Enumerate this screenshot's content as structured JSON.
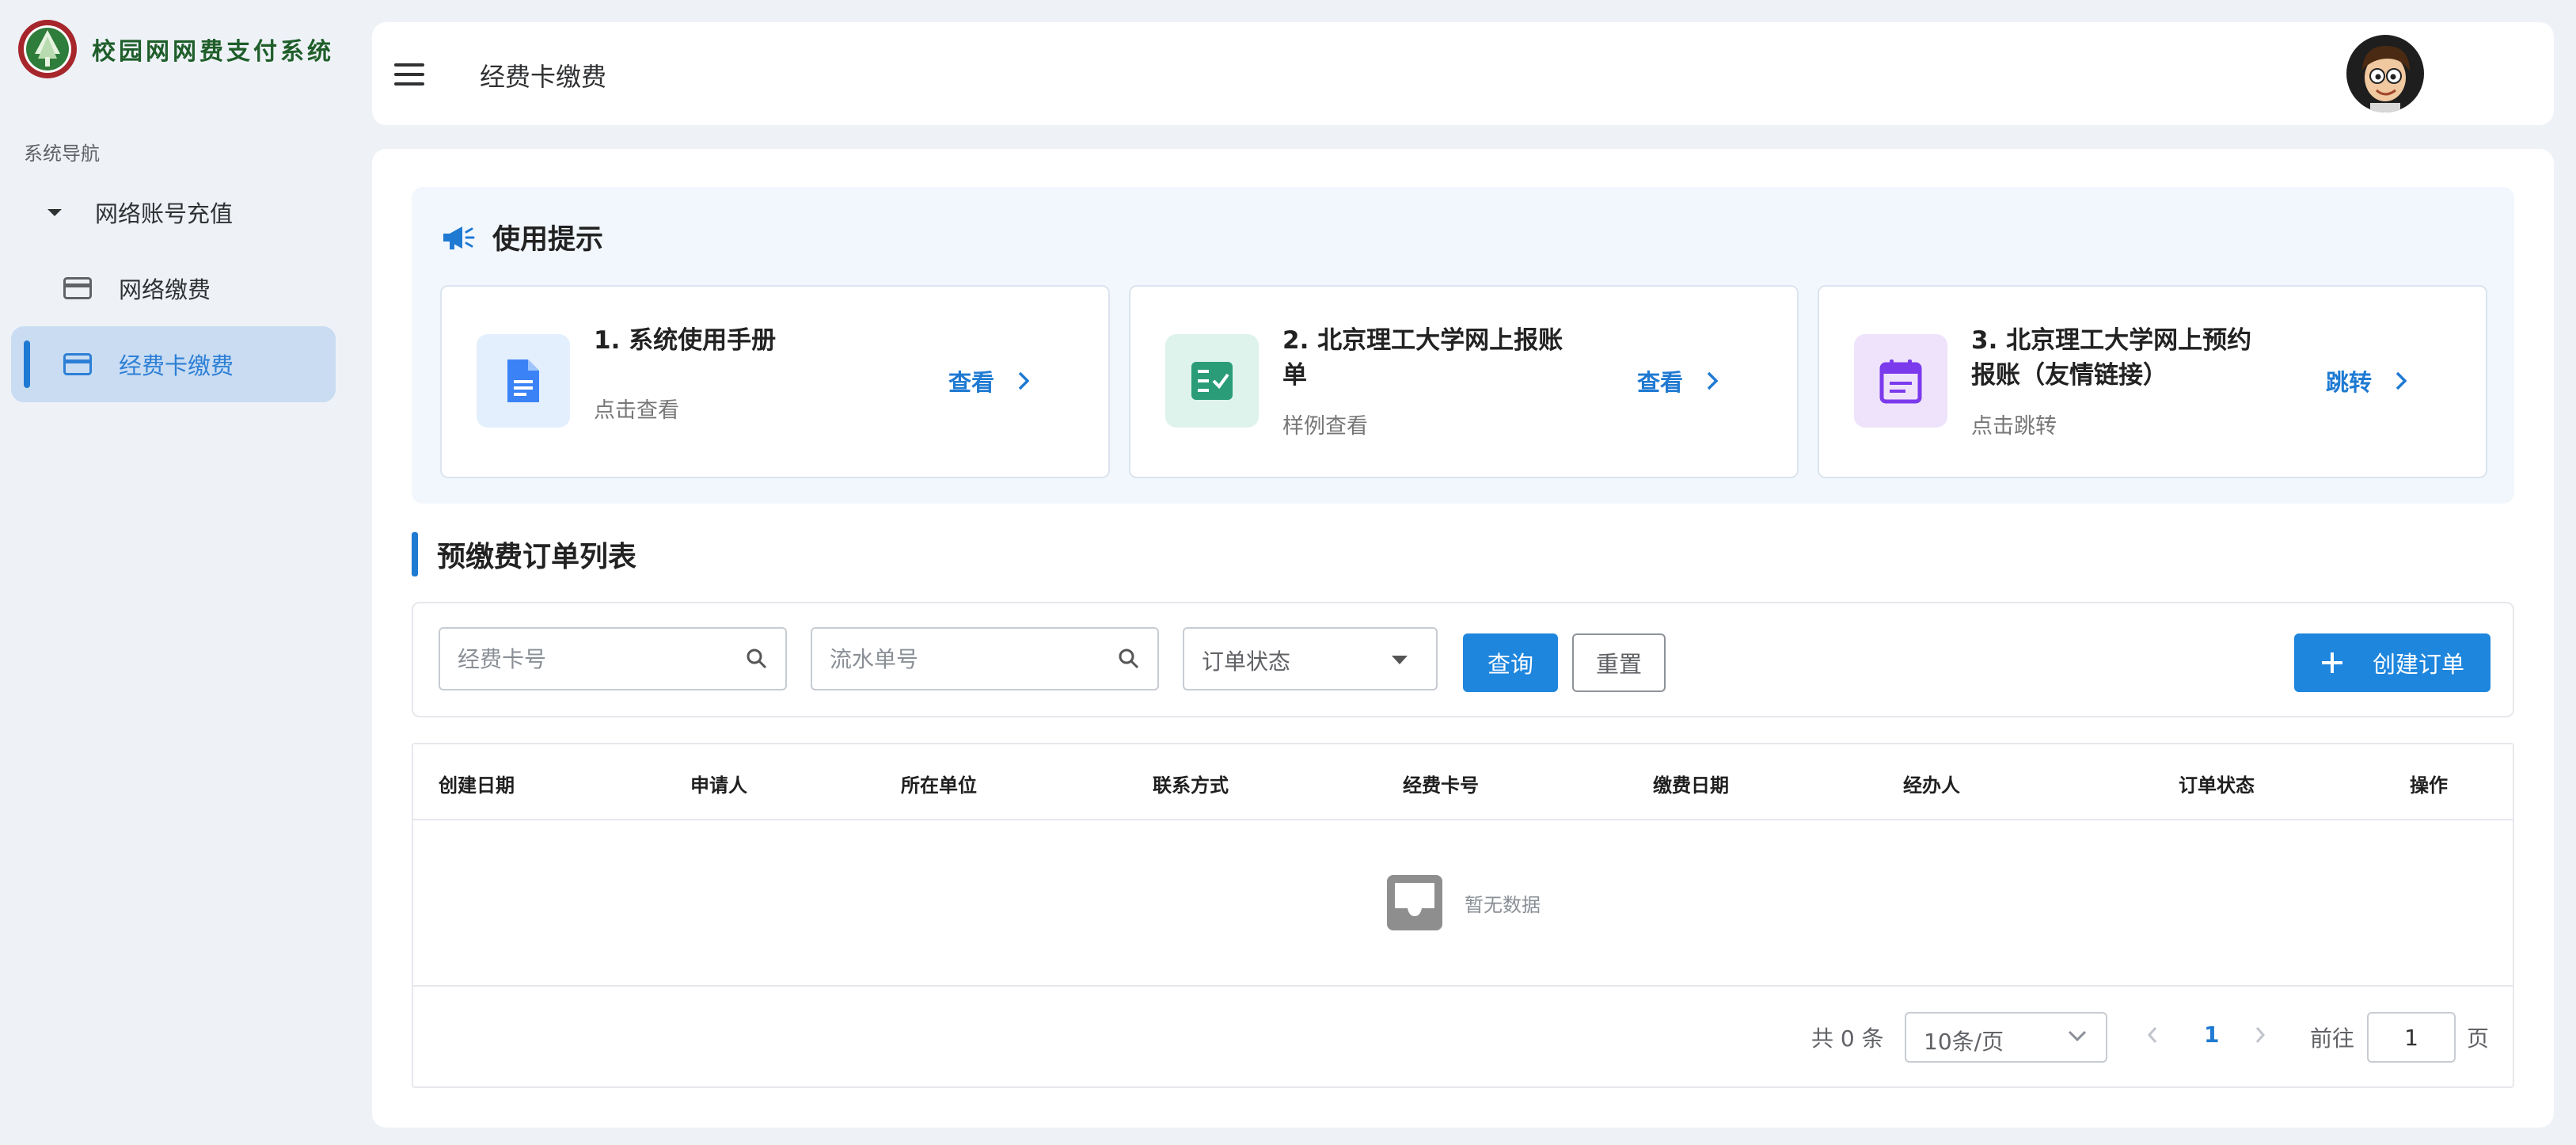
{
  "app": {
    "title": "校园网网费支付系统"
  },
  "sidebar": {
    "caption": "系统导航",
    "group": {
      "label": "网络账号充值"
    },
    "items": [
      {
        "label": "网络缴费"
      },
      {
        "label": "经费卡缴费"
      }
    ]
  },
  "header": {
    "title": "经费卡缴费"
  },
  "tips": {
    "title": "使用提示",
    "cards": [
      {
        "title": "1. 系统使用手册",
        "subtitle": "点击查看",
        "link": "查看",
        "icon": "document-icon",
        "color": "#3b82f6",
        "bg": "#e3effd"
      },
      {
        "title": "2. 北京理工大学网上报账单",
        "subtitle": "样例查看",
        "link": "查看",
        "icon": "checklist-icon",
        "color": "#2a9d78",
        "bg": "#def3ec"
      },
      {
        "title": "3. 北京理工大学网上预约报账（友情链接）",
        "subtitle": "点击跳转",
        "link": "跳转",
        "icon": "calendar-icon",
        "color": "#7c3aed",
        "bg": "#efe3fb"
      }
    ]
  },
  "orders": {
    "title": "预缴费订单列表",
    "filters": {
      "card_no_placeholder": "经费卡号",
      "serial_no_placeholder": "流水单号",
      "status_placeholder": "订单状态"
    },
    "buttons": {
      "query": "查询",
      "reset": "重置",
      "create": "创建订单"
    },
    "columns": [
      "创建日期",
      "申请人",
      "所在单位",
      "联系方式",
      "经费卡号",
      "缴费日期",
      "经办人",
      "订单状态",
      "操作"
    ],
    "empty_text": "暂无数据",
    "pagination": {
      "total": "共 0 条",
      "page_size": "10条/页",
      "current_page": "1",
      "goto_label": "前往",
      "goto_value": "1",
      "page_unit": "页"
    }
  },
  "colors": {
    "accent": "#1f86de",
    "active_bg": "#c9dcf2",
    "page_bg": "#eef2f7"
  }
}
